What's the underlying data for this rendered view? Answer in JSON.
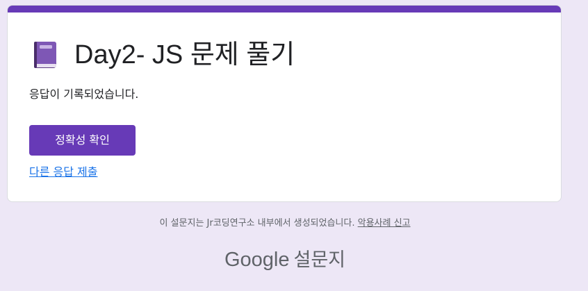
{
  "form": {
    "title": "Day2- JS 문제 풀기",
    "title_icon": "book-icon",
    "confirmation_message": "응답이 기록되었습니다.",
    "accent_color": "#673ab7"
  },
  "actions": {
    "view_score_label": "정확성 확인",
    "submit_another_label": "다른 응답 제출"
  },
  "footer": {
    "note": "이 설문지는 Jr코딩연구소 내부에서 생성되었습니다.",
    "report_abuse_label": "악용사례 신고",
    "brand_google": "Google",
    "brand_product": "설문지"
  }
}
